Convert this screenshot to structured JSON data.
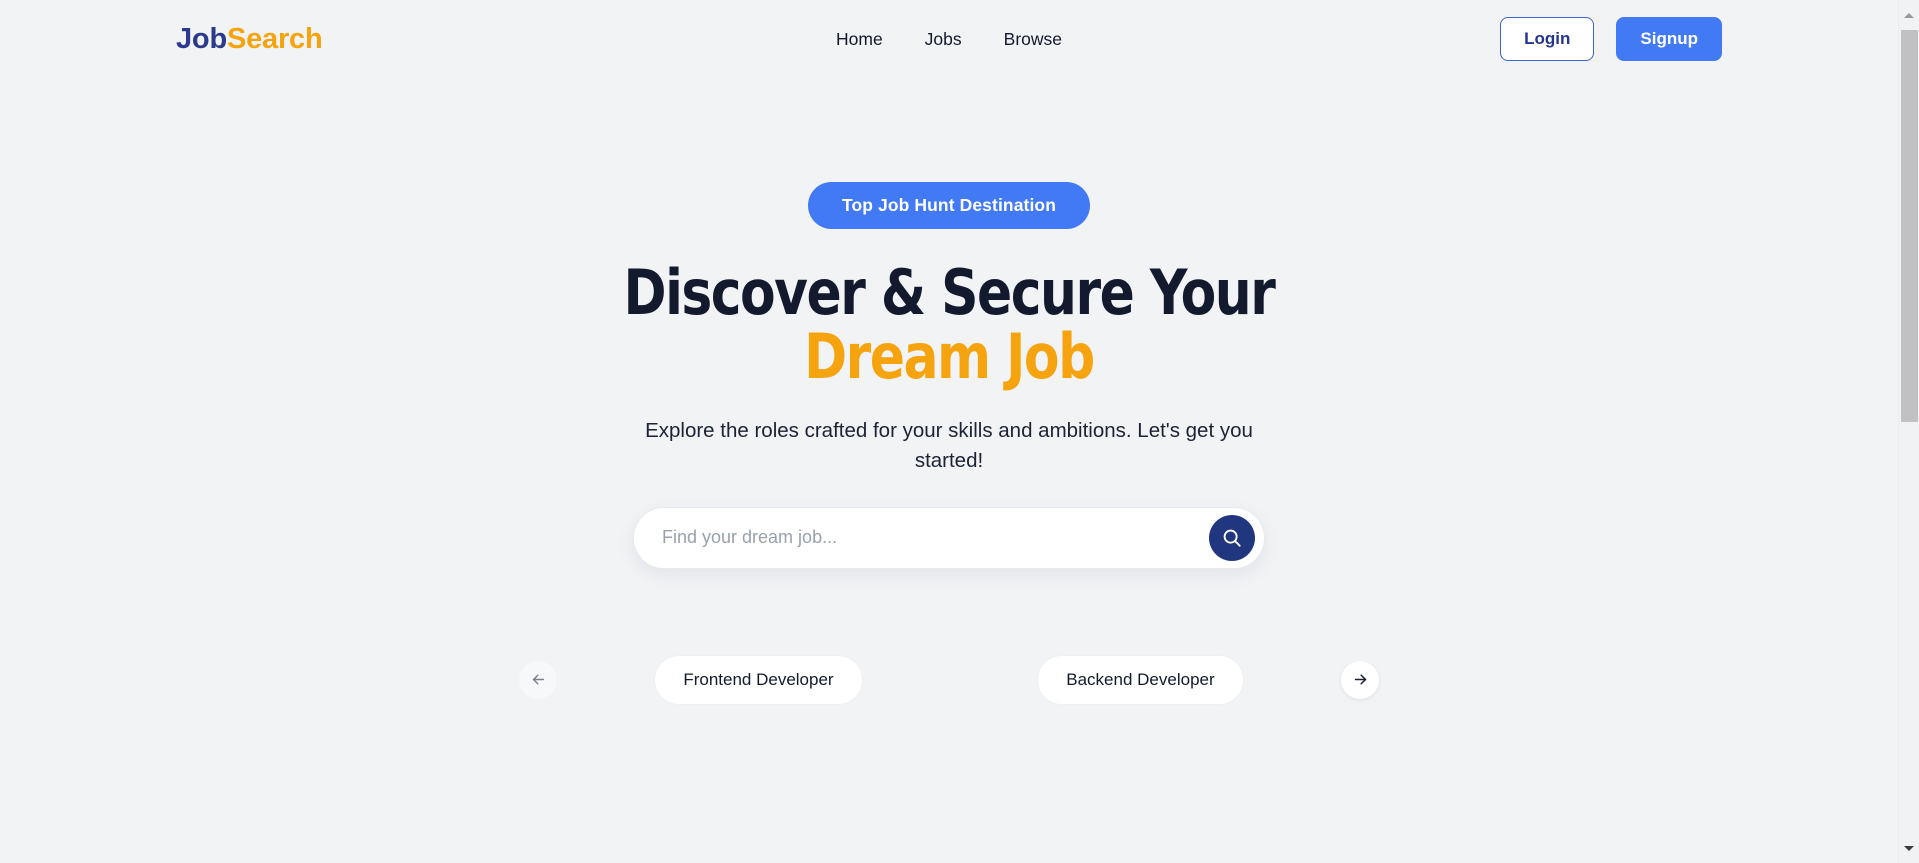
{
  "navbar": {
    "logo": {
      "part1": "Job",
      "part2": "Search"
    },
    "links": [
      {
        "label": "Home"
      },
      {
        "label": "Jobs"
      },
      {
        "label": "Browse"
      }
    ],
    "login_label": "Login",
    "signup_label": "Signup"
  },
  "hero": {
    "badge": "Top Job Hunt Destination",
    "headline_line1": "Discover & Secure Your",
    "headline_line2": "Dream Job",
    "subtitle": "Explore the roles crafted for your skills and ambitions. Let's get you started!"
  },
  "search": {
    "placeholder": "Find your dream job...",
    "value": "",
    "button_icon": "search-icon"
  },
  "carousel": {
    "prev_icon": "arrow-left-icon",
    "next_icon": "arrow-right-icon",
    "chips": [
      {
        "label": "Frontend Developer"
      },
      {
        "label": "Backend Developer"
      }
    ]
  },
  "colors": {
    "background": "#f1f3f5",
    "brand_blue": "#4279f4",
    "brand_navy": "#2b3a8f",
    "brand_orange": "#f5a40f",
    "search_button": "#20367f",
    "heading": "#141a2e"
  },
  "scrollbar": {
    "up_icon": "scroll-up-arrow-icon",
    "down_icon": "scroll-down-arrow-icon"
  }
}
